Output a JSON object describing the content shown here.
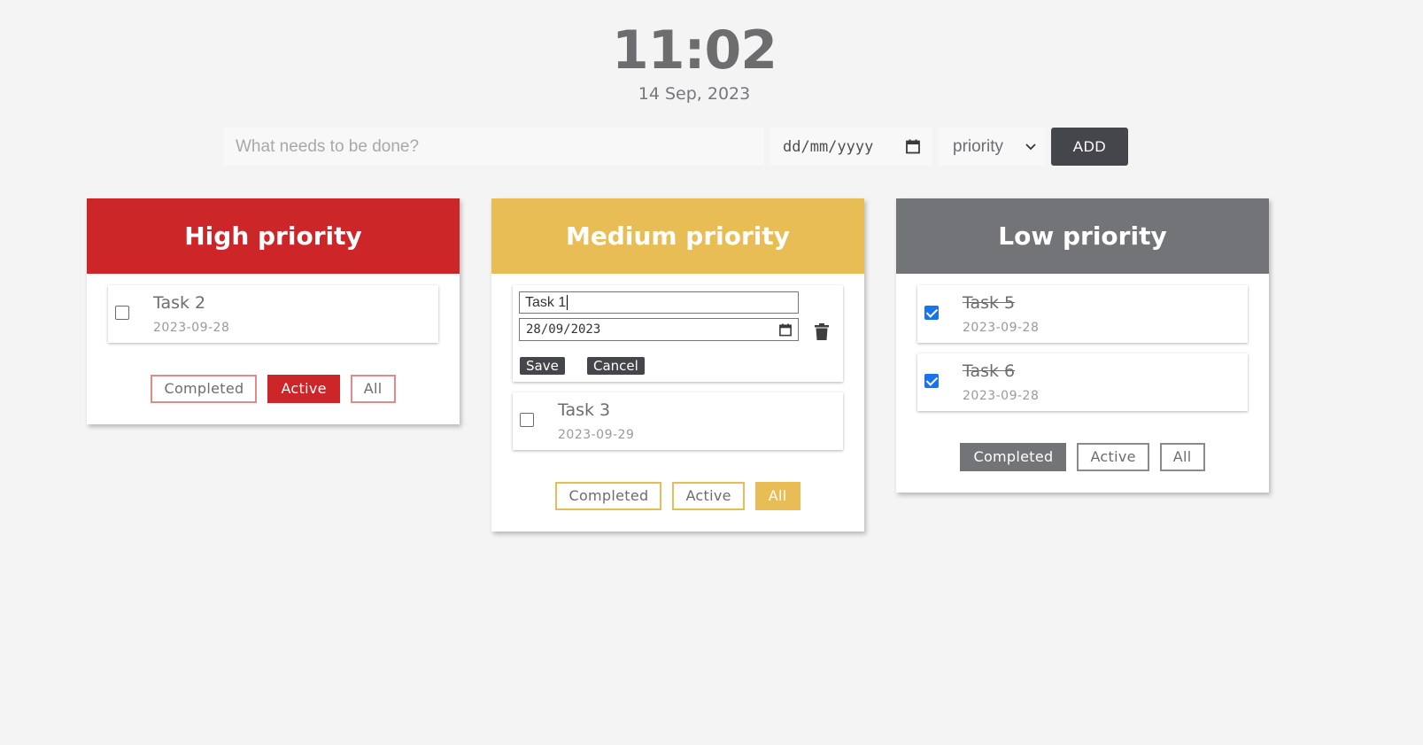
{
  "clock": {
    "time": "11:02",
    "date": "14 Sep, 2023"
  },
  "addbar": {
    "task_placeholder": "What needs to be done?",
    "date_placeholder": "dd/mm/yyyy",
    "priority_label": "priority",
    "add_label": "ADD"
  },
  "colors": {
    "high": "#cc2628",
    "medium": "#e8bd56",
    "low": "#737478",
    "dark": "#45464b"
  },
  "columns": {
    "high": {
      "title": "High priority",
      "tasks": [
        {
          "title": "Task 2",
          "date": "2023-09-28",
          "done": false
        }
      ],
      "filters": {
        "completed": "Completed",
        "active": "Active",
        "all": "All",
        "selected": "Active"
      }
    },
    "medium": {
      "title": "Medium priority",
      "editing": {
        "name": "Task 1",
        "date": "28/09/2023",
        "save": "Save",
        "cancel": "Cancel"
      },
      "tasks": [
        {
          "title": "Task 3",
          "date": "2023-09-29",
          "done": false
        }
      ],
      "filters": {
        "completed": "Completed",
        "active": "Active",
        "all": "All",
        "selected": "All"
      }
    },
    "low": {
      "title": "Low priority",
      "tasks": [
        {
          "title": "Task 5",
          "date": "2023-09-28",
          "done": true
        },
        {
          "title": "Task 6",
          "date": "2023-09-28",
          "done": true
        }
      ],
      "filters": {
        "completed": "Completed",
        "active": "Active",
        "all": "All",
        "selected": "Completed"
      }
    }
  }
}
